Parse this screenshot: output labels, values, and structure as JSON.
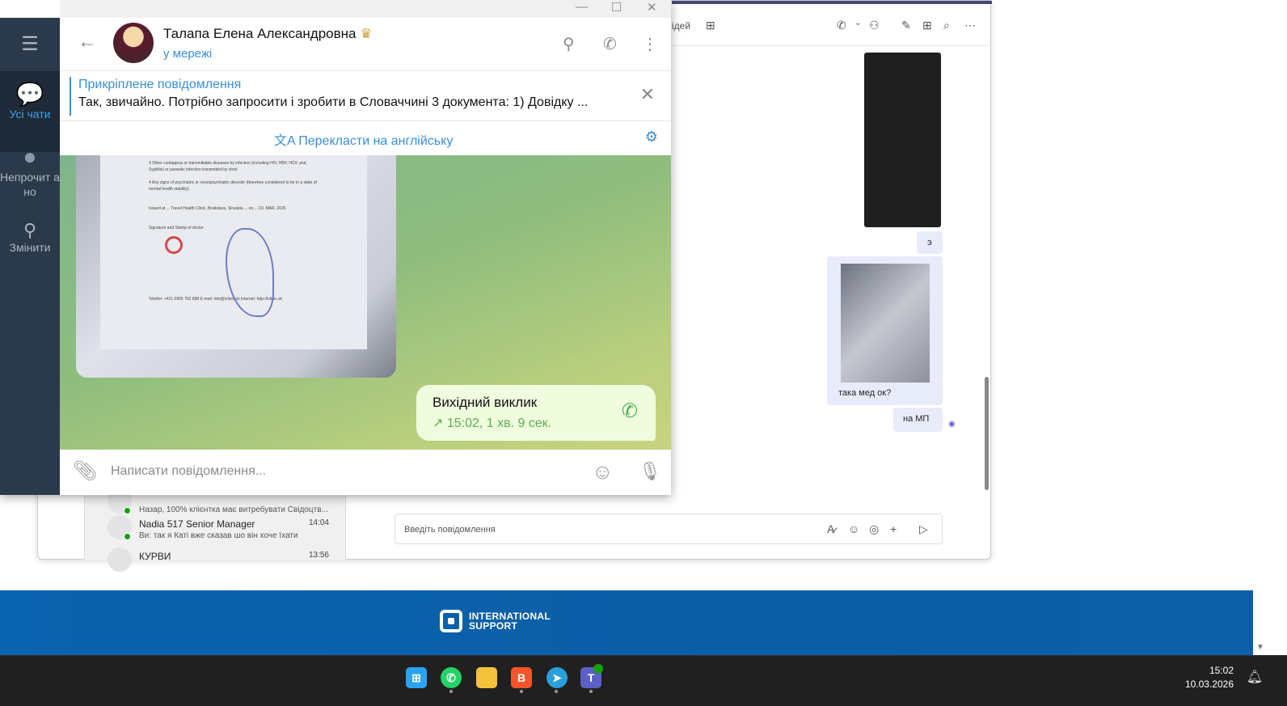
{
  "telegram": {
    "window_controls": [
      "minimize",
      "maximize",
      "close"
    ],
    "sidebar": {
      "items": [
        {
          "label": "Усі чати",
          "icon": "chats-icon",
          "active": true
        },
        {
          "label": "Непрочит ано",
          "icon": "person-icon"
        },
        {
          "label": "Змінити",
          "icon": "sliders-icon"
        }
      ]
    },
    "header": {
      "name": "Талапа Елена Александровна",
      "status": "у мережі"
    },
    "pinned": {
      "title": "Прикріплене повідомлення",
      "text": "Так, звичайно. Потрібно запросити і зробити в Словаччині 3 документа: 1) Довідку ..."
    },
    "translate": {
      "label": "Перекласти на англійську"
    },
    "document": {
      "lines": [
        "3  Other contagious or transmittable diseases by infection (including HIV, HBV, HCV, and Syphilis) or parasitic infection transmitted by stool",
        "4  Any signs of psychiatric or neuropsychiatric disorder (therefore considered to be in a state of mental health stability)",
        "Issued at ... Travel Health Clinic, Bratislava, Slovakia ... on ... 03. MAR. 2026",
        "Signature and Stamp of doctor",
        "Telefón: +421 0905 762 888   E-mail: info@tclinic.sk   Internet: http://tclinic.sk"
      ]
    },
    "call": {
      "title": "Вихідний виклик",
      "details": "15:02, 1 хв. 9 сек.",
      "accent": "#4fae4e"
    },
    "input": {
      "placeholder": "Написати повідомлення..."
    },
    "colors": {
      "sidebar": "#2b3a4b",
      "accent": "#3a8fd6"
    }
  },
  "teams": {
    "header": {
      "partial_title": "ідей"
    },
    "messages": [
      {
        "text": "э"
      },
      {
        "text": "така мед ок?"
      },
      {
        "text": "на МП"
      }
    ],
    "chat_list": [
      {
        "name": "",
        "preview": "Назар, 100% клієнтка має витребувати Свідоцтв...",
        "time": ""
      },
      {
        "name": "Nadia 517 Senior Manager",
        "preview": "Ви: так я Каті вже сказав шо він хоче їхати",
        "time": "14:04"
      },
      {
        "name": "КУРВИ",
        "preview": "",
        "time": "13:56"
      }
    ],
    "input": {
      "placeholder": "Введіть повідомлення"
    }
  },
  "website": {
    "logo_line1": "INTERNATIONAL",
    "logo_line2": "SUPPORT"
  },
  "taskbar": {
    "apps": [
      "windows-start",
      "whatsapp",
      "file-explorer",
      "brave",
      "telegram",
      "teams"
    ],
    "time": "15:02",
    "date": "10.03.2026"
  }
}
